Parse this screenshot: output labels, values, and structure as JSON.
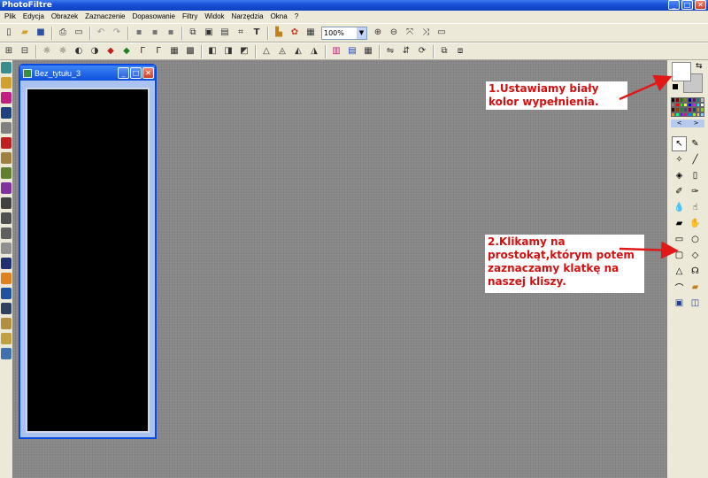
{
  "window": {
    "title": "PhotoFiltre",
    "minimize": "_",
    "maximize": "□",
    "close": "✕"
  },
  "menu": [
    "Plik",
    "Edycja",
    "Obrazek",
    "Zaznaczenie",
    "Dopasowanie",
    "Filtry",
    "Widok",
    "Narzędzia",
    "Okna",
    "?"
  ],
  "toolbar": {
    "zoom_value": "100%",
    "dropdown": "▼"
  },
  "document": {
    "title": "Bez_tytułu_3",
    "minimize": "_",
    "maximize": "□",
    "close": "✕"
  },
  "palette_nav": {
    "left": "<",
    "right": ">"
  },
  "annotations": {
    "note1": "1.Ustawiamy biały kolor wypełnienia.",
    "note2": "2.Klikamy na prostokąt,którym potem zaznaczamy klatkę na naszej kliszy."
  },
  "colors": {
    "annotation": "#d41010",
    "arrow": "#e01818",
    "foreground": "#ffffff",
    "background": "#c8c8c8"
  },
  "icons": {
    "tb1": [
      "new-file-icon",
      "open-folder-icon",
      "save-icon",
      "print-icon",
      "scan-icon",
      "undo-icon",
      "redo-icon",
      "copy-icon",
      "paste-icon",
      "paste-new-icon",
      "duplicate-icon",
      "crop-icon",
      "resize-icon",
      "text-icon",
      "import-icon",
      "automate-icon",
      "zoom-in-icon",
      "zoom-out-icon",
      "zoom-fit-icon",
      "zoom-actual-icon",
      "fullscreen-icon"
    ],
    "tools": [
      "selection-arrow-icon",
      "eyedropper-icon",
      "magic-wand-icon",
      "line-icon",
      "fill-bucket-icon",
      "spray-icon",
      "brush-icon",
      "eraser-icon",
      "blur-drop-icon",
      "smudge-icon",
      "clone-stamp-icon",
      "hand-icon",
      "rectangle-icon",
      "ellipse-icon",
      "rounded-rect-icon",
      "diamond-icon",
      "triangle-icon",
      "lasso-icon",
      "polygon-lasso-icon",
      "open-shape-icon",
      "select-all-icon",
      "invert-select-icon"
    ]
  }
}
